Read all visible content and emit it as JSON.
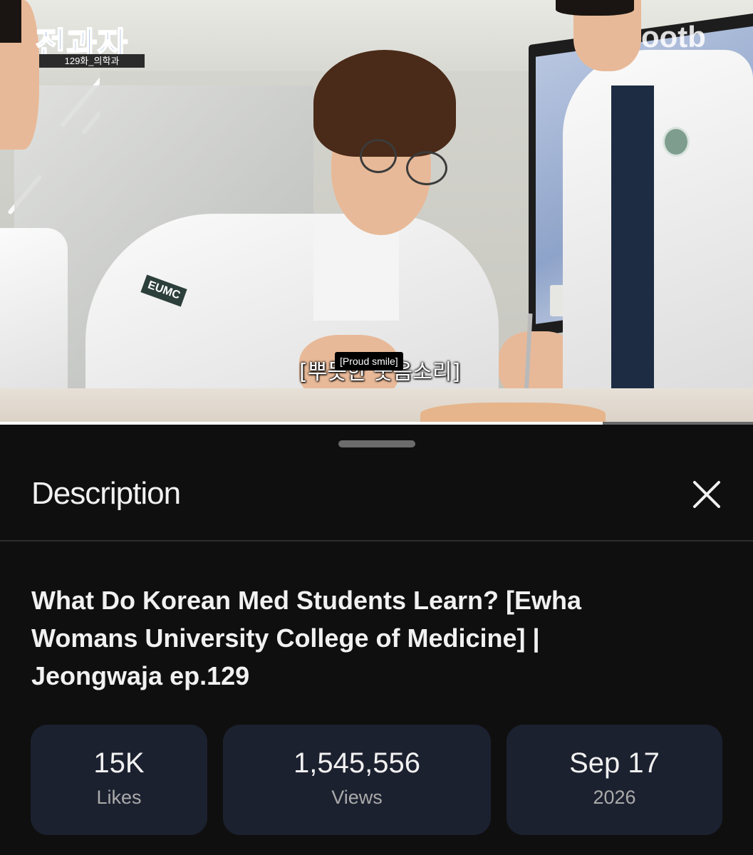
{
  "video": {
    "show_logo": "전과자",
    "episode_tag": "129화_의학과",
    "channel_watermark": "ootb",
    "korean_subtitle": "[뿌듯한 웃음소리]",
    "caption": "[Proud smile]",
    "progress_fraction": 0.8
  },
  "description_panel": {
    "heading": "Description",
    "video_title": "What Do Korean Med Students Learn? [Ewha Womans University College of Medicine] | Jeongwaja ep.129",
    "stats": [
      {
        "value": "15K",
        "label": "Likes"
      },
      {
        "value": "1,545,556",
        "label": "Views"
      },
      {
        "value": "Sep 17",
        "label": "2026"
      }
    ]
  },
  "colors": {
    "background": "#0f0f0f",
    "stat_card": "#1c2130",
    "secondary_text": "#aaaaaa"
  },
  "icons": {
    "close": "close-icon",
    "drag_handle": "drag-handle"
  }
}
